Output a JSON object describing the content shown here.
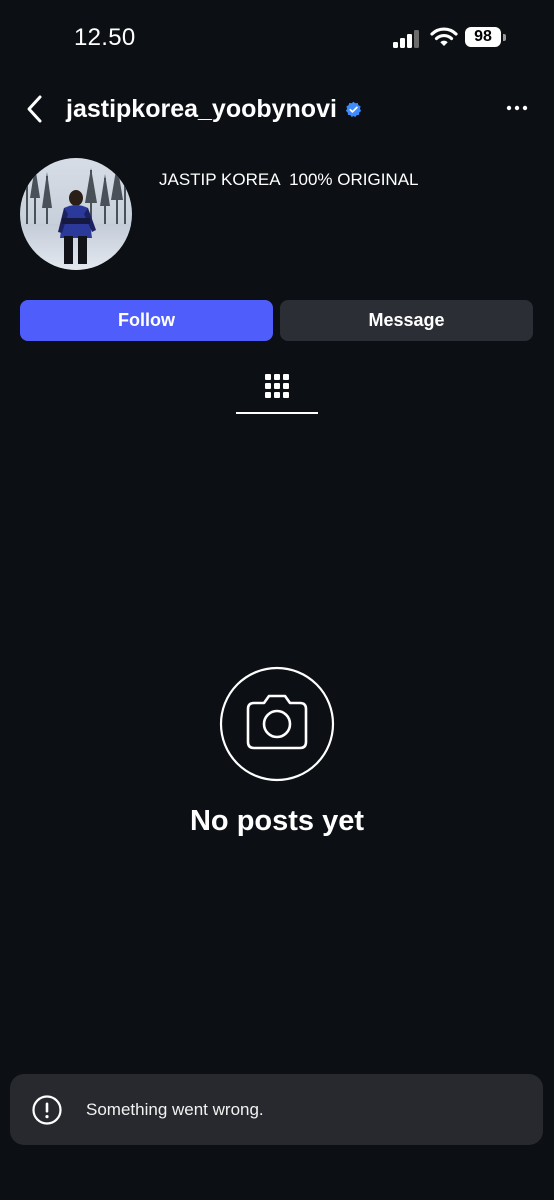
{
  "status_bar": {
    "time": "12.50",
    "battery": "98"
  },
  "header": {
    "username": "jastipkorea_yoobynovi",
    "verified_icon": "verified-badge-icon",
    "back_icon": "chevron-left-icon",
    "more_icon": "more-horizontal-icon"
  },
  "profile": {
    "bio": "JASTIP KOREA  100% ORIGINAL"
  },
  "actions": {
    "follow_label": "Follow",
    "message_label": "Message"
  },
  "tabs": {
    "active": "grid-icon"
  },
  "empty_state": {
    "icon": "camera-icon",
    "text": "No posts yet"
  },
  "toast": {
    "icon": "exclamation-circle-icon",
    "text": "Something went wrong."
  },
  "colors": {
    "background": "#0c0f14",
    "follow_button": "#4f5dfb",
    "message_button": "#2b2e35",
    "verified": "#3d8bff",
    "toast_background": "#27292e"
  }
}
